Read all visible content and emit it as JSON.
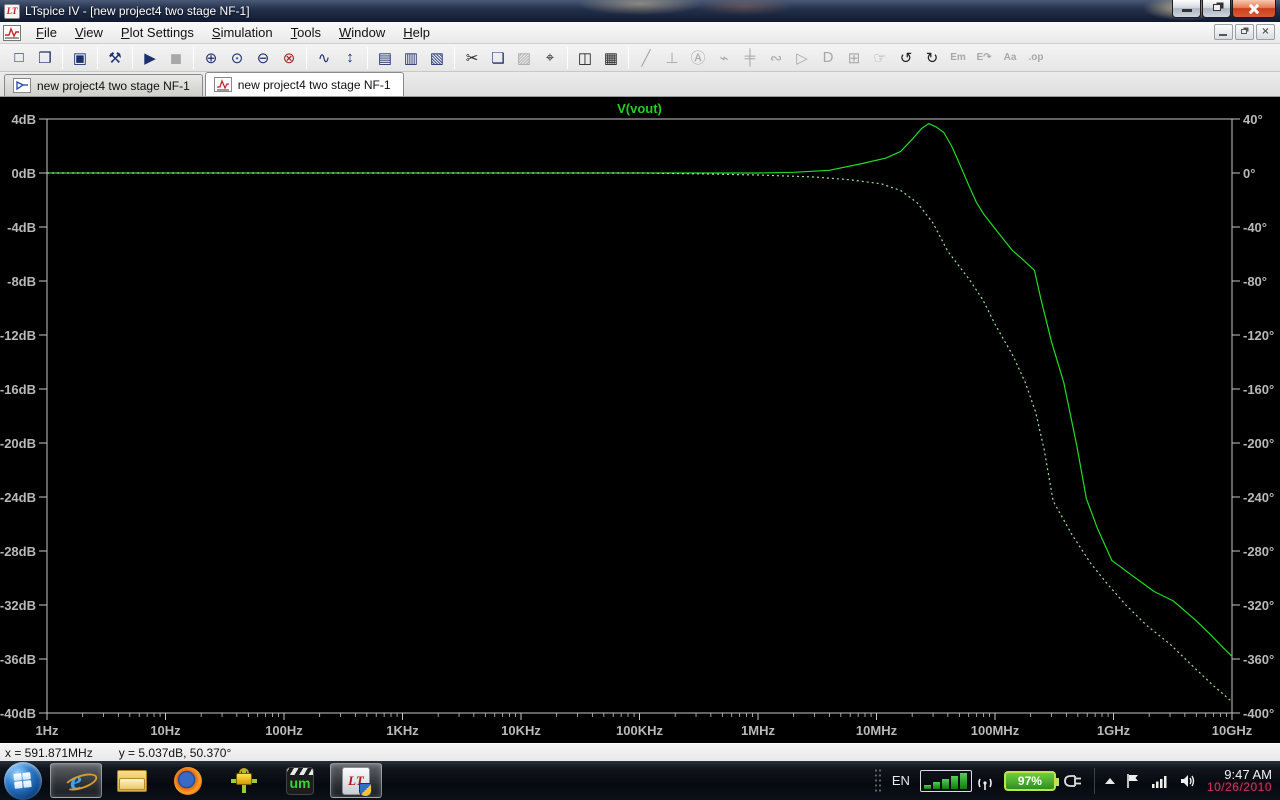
{
  "window": {
    "title": "LTspice IV - [new project4 two stage NF-1]"
  },
  "menu": {
    "items": [
      "File",
      "View",
      "Plot Settings",
      "Simulation",
      "Tools",
      "Window",
      "Help"
    ]
  },
  "toolbar": {
    "groups": [
      [
        {
          "name": "new-schematic",
          "glyph": "□",
          "enabled": true
        },
        {
          "name": "open",
          "glyph": "❒",
          "enabled": true
        }
      ],
      [
        {
          "name": "save",
          "glyph": "▣",
          "enabled": true
        }
      ],
      [
        {
          "name": "control-panel",
          "glyph": "⚒",
          "enabled": true
        }
      ],
      [
        {
          "name": "run",
          "glyph": "▶",
          "enabled": true
        },
        {
          "name": "halt",
          "glyph": "◼",
          "enabled": false
        }
      ],
      [
        {
          "name": "zoom-area",
          "glyph": "⊕",
          "enabled": true
        },
        {
          "name": "zoom-back",
          "glyph": "⊙",
          "enabled": true
        },
        {
          "name": "zoom-out",
          "glyph": "⊖",
          "enabled": true
        },
        {
          "name": "zoom-full-extents",
          "glyph": "⊗",
          "enabled": true,
          "tint": "red"
        }
      ],
      [
        {
          "name": "autorange-y-axis",
          "glyph": "∿",
          "enabled": true
        },
        {
          "name": "manual-axis-limits",
          "glyph": "↕",
          "enabled": true
        }
      ],
      [
        {
          "name": "tile-horizontally",
          "glyph": "▤",
          "enabled": true
        },
        {
          "name": "tile-vertically",
          "glyph": "▥",
          "enabled": true
        },
        {
          "name": "cascade-windows",
          "glyph": "▧",
          "enabled": true
        }
      ],
      [
        {
          "name": "cut",
          "glyph": "✂",
          "enabled": true,
          "tint": "dark"
        },
        {
          "name": "copy",
          "glyph": "❏",
          "enabled": true
        },
        {
          "name": "paste",
          "glyph": "▨",
          "enabled": false
        },
        {
          "name": "find",
          "glyph": "⌖",
          "enabled": true,
          "tint": "dark"
        }
      ],
      [
        {
          "name": "print-preview",
          "glyph": "◫",
          "enabled": true,
          "tint": "dark"
        },
        {
          "name": "print",
          "glyph": "▦",
          "enabled": true,
          "tint": "dark"
        }
      ],
      [
        {
          "name": "draw-wire",
          "glyph": "╱",
          "enabled": false
        },
        {
          "name": "ground",
          "glyph": "⊥",
          "enabled": false
        },
        {
          "name": "net-label",
          "glyph": "Ⓐ",
          "enabled": false
        },
        {
          "name": "resistor",
          "glyph": "⌁",
          "enabled": false
        },
        {
          "name": "capacitor",
          "glyph": "╪",
          "enabled": false
        },
        {
          "name": "inductor",
          "glyph": "∾",
          "enabled": false
        },
        {
          "name": "diode",
          "glyph": "▷",
          "enabled": false
        },
        {
          "name": "component",
          "glyph": "D",
          "enabled": false
        },
        {
          "name": "move",
          "glyph": "⊞",
          "enabled": false
        },
        {
          "name": "drag",
          "glyph": "☞",
          "enabled": false
        },
        {
          "name": "undo",
          "glyph": "↺",
          "enabled": true,
          "tint": "dark"
        },
        {
          "name": "redo",
          "glyph": "↻",
          "enabled": true,
          "tint": "dark"
        },
        {
          "name": "mirror",
          "glyph": "Em",
          "enabled": false,
          "small": true
        },
        {
          "name": "rotate",
          "glyph": "E↷",
          "enabled": false,
          "small": true
        },
        {
          "name": "text",
          "glyph": "Aa",
          "enabled": false,
          "small": true
        },
        {
          "name": "spice-directive",
          "glyph": ".op",
          "enabled": false,
          "small": true
        }
      ]
    ]
  },
  "tabs": [
    {
      "label": "new project4 two stage NF-1",
      "active": false,
      "kind": "schematic"
    },
    {
      "label": "new project4 two stage NF-1",
      "active": true,
      "kind": "waveform"
    }
  ],
  "status": {
    "x_readout": "x = 591.871MHz",
    "y_readout": "y = 5.037dB, 50.370°"
  },
  "taskbar": {
    "um_label": "um",
    "ltspice_monogram": "LT"
  },
  "tray": {
    "language": "EN",
    "battery": "97%",
    "time": "9:47 AM",
    "date": "10/26/2010"
  },
  "chart_data": {
    "type": "line",
    "title": "V(vout)",
    "background": "#000000",
    "axis_color": "#c6c6c6",
    "grid": false,
    "x_axis": {
      "scale": "log",
      "min_hz": 1,
      "max_hz": 10000000000,
      "tick_labels": [
        "1Hz",
        "10Hz",
        "100Hz",
        "1KHz",
        "10KHz",
        "100KHz",
        "1MHz",
        "10MHz",
        "100MHz",
        "1GHz",
        "10GHz"
      ]
    },
    "y_left_axis": {
      "label": "magnitude",
      "unit": "dB",
      "max": 4,
      "min": -40,
      "step": -4,
      "tick_labels": [
        "4dB",
        "0dB",
        "-4dB",
        "-8dB",
        "-12dB",
        "-16dB",
        "-20dB",
        "-24dB",
        "-28dB",
        "-32dB",
        "-36dB",
        "-40dB"
      ]
    },
    "y_right_axis": {
      "label": "phase",
      "unit": "deg",
      "max": 40,
      "min": -400,
      "step": -40,
      "tick_labels": [
        "40°",
        "0°",
        "-40°",
        "-80°",
        "-120°",
        "-160°",
        "-200°",
        "-240°",
        "-280°",
        "-320°",
        "-360°",
        "-400°"
      ]
    },
    "series": [
      {
        "name": "V(vout) magnitude",
        "style": "solid",
        "axis": "left",
        "color": "#22dd22",
        "points": [
          [
            1,
            0
          ],
          [
            1000000,
            0
          ],
          [
            2000000,
            0.05
          ],
          [
            4000000,
            0.2
          ],
          [
            7600000,
            0.7
          ],
          [
            12000000,
            1.1
          ],
          [
            16000000,
            1.6
          ],
          [
            20000000,
            2.5
          ],
          [
            24000000,
            3.3
          ],
          [
            27500000,
            3.66
          ],
          [
            32000000,
            3.4
          ],
          [
            37000000,
            3.0
          ],
          [
            43000000,
            2.0
          ],
          [
            49000000,
            0.9
          ],
          [
            60000000,
            -0.9
          ],
          [
            70000000,
            -2.2
          ],
          [
            81000000,
            -3.1
          ],
          [
            104000000,
            -4.3
          ],
          [
            139000000,
            -5.7
          ],
          [
            166000000,
            -6.3
          ],
          [
            215000000,
            -7.2
          ],
          [
            245000000,
            -9.4
          ],
          [
            300000000,
            -12.5
          ],
          [
            380000000,
            -15.5
          ],
          [
            490000000,
            -20.2
          ],
          [
            590000000,
            -24.1
          ],
          [
            730000000,
            -26.3
          ],
          [
            970000000,
            -28.7
          ],
          [
            1430000000,
            -29.8
          ],
          [
            2200000000,
            -31.0
          ],
          [
            3200000000,
            -31.7
          ],
          [
            4900000000,
            -33.1
          ],
          [
            6600000000,
            -34.2
          ],
          [
            8500000000,
            -35.2
          ],
          [
            10000000000,
            -35.8
          ]
        ]
      },
      {
        "name": "V(vout) phase",
        "style": "dashed",
        "axis": "right",
        "color": "#9be09b",
        "points": [
          [
            1,
            0
          ],
          [
            100000,
            0
          ],
          [
            300000,
            -0.6
          ],
          [
            1000000,
            -1.5
          ],
          [
            3000000,
            -3
          ],
          [
            6000000,
            -5
          ],
          [
            11000000,
            -8
          ],
          [
            16000000,
            -13
          ],
          [
            22000000,
            -22
          ],
          [
            30000000,
            -37
          ],
          [
            40000000,
            -58
          ],
          [
            62000000,
            -80
          ],
          [
            79000000,
            -94
          ],
          [
            100000000,
            -112
          ],
          [
            143000000,
            -136
          ],
          [
            180000000,
            -155
          ],
          [
            220000000,
            -177
          ],
          [
            260000000,
            -205
          ],
          [
            310000000,
            -243
          ],
          [
            440000000,
            -267
          ],
          [
            640000000,
            -289
          ],
          [
            880000000,
            -304
          ],
          [
            1270000000,
            -320
          ],
          [
            1900000000,
            -335
          ],
          [
            3000000000,
            -349
          ],
          [
            4500000000,
            -364
          ],
          [
            6800000000,
            -379
          ],
          [
            9800000000,
            -391
          ]
        ]
      }
    ]
  }
}
